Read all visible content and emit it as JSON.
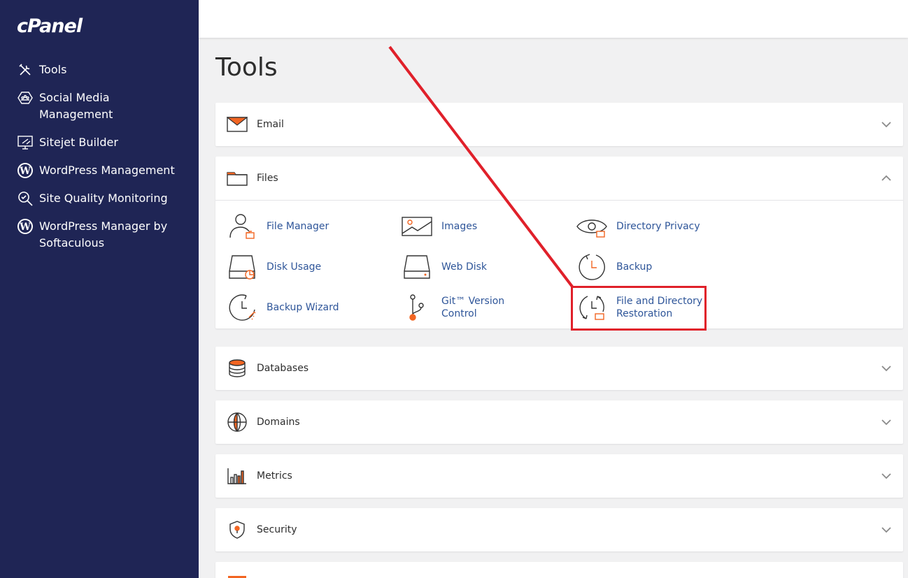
{
  "brand": {
    "logo": "cPanel"
  },
  "sidebar": {
    "items": [
      {
        "label": "Tools",
        "icon": "tools-icon"
      },
      {
        "label": "Social Media Management",
        "icon": "social-media-icon"
      },
      {
        "label": "Sitejet Builder",
        "icon": "sitejet-icon"
      },
      {
        "label": "WordPress Management",
        "icon": "wordpress-icon"
      },
      {
        "label": "Site Quality Monitoring",
        "icon": "magnifier-icon"
      },
      {
        "label": "WordPress Manager by Softaculous",
        "icon": "wordpress-icon"
      }
    ]
  },
  "page": {
    "title": "Tools"
  },
  "sections": {
    "email": {
      "title": "Email",
      "expanded": false
    },
    "files": {
      "title": "Files",
      "expanded": true,
      "tools": [
        {
          "label": "File Manager",
          "icon": "file-manager-icon"
        },
        {
          "label": "Images",
          "icon": "images-icon"
        },
        {
          "label": "Directory Privacy",
          "icon": "directory-privacy-icon"
        },
        {
          "label": "Disk Usage",
          "icon": "disk-usage-icon"
        },
        {
          "label": "Web Disk",
          "icon": "web-disk-icon"
        },
        {
          "label": "Backup",
          "icon": "backup-icon"
        },
        {
          "label": "Backup Wizard",
          "icon": "backup-wizard-icon"
        },
        {
          "label": "Git™ Version Control",
          "icon": "git-icon"
        },
        {
          "label": "File and Directory Restoration",
          "icon": "restoration-icon"
        }
      ]
    },
    "databases": {
      "title": "Databases",
      "expanded": false
    },
    "domains": {
      "title": "Domains",
      "expanded": false
    },
    "metrics": {
      "title": "Metrics",
      "expanded": false
    },
    "security": {
      "title": "Security",
      "expanded": false
    }
  },
  "colors": {
    "sidebar": "#1f2555",
    "accent": "#f26522",
    "link": "#2e5599",
    "annotation": "#e0202a"
  }
}
